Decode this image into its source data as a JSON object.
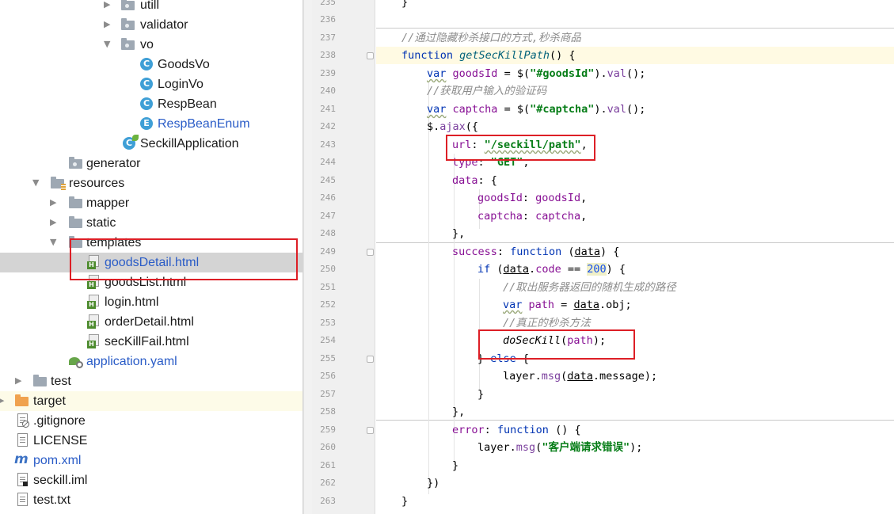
{
  "tree": {
    "items": [
      {
        "label": "utill",
        "type": "folder"
      },
      {
        "label": "validator",
        "type": "folder"
      },
      {
        "label": "vo",
        "type": "folder"
      },
      {
        "label": "GoodsVo",
        "type": "class"
      },
      {
        "label": "LoginVo",
        "type": "class"
      },
      {
        "label": "RespBean",
        "type": "class"
      },
      {
        "label": "RespBeanEnum",
        "type": "enum"
      },
      {
        "label": "SeckillApplication",
        "type": "spring-class"
      },
      {
        "label": "generator",
        "type": "folder"
      },
      {
        "label": "resources",
        "type": "resources-folder"
      },
      {
        "label": "mapper",
        "type": "folder"
      },
      {
        "label": "static",
        "type": "folder"
      },
      {
        "label": "templates",
        "type": "folder"
      },
      {
        "label": "goodsDetail.html",
        "type": "html"
      },
      {
        "label": "goodsList.html",
        "type": "html"
      },
      {
        "label": "login.html",
        "type": "html"
      },
      {
        "label": "orderDetail.html",
        "type": "html"
      },
      {
        "label": "secKillFail.html",
        "type": "html"
      },
      {
        "label": "application.yaml",
        "type": "yaml"
      },
      {
        "label": "test",
        "type": "folder"
      },
      {
        "label": "target",
        "type": "excluded-folder"
      },
      {
        "label": ".gitignore",
        "type": "file"
      },
      {
        "label": "LICENSE",
        "type": "file"
      },
      {
        "label": "pom.xml",
        "type": "maven"
      },
      {
        "label": "seckill.iml",
        "type": "iml"
      },
      {
        "label": "test.txt",
        "type": "file"
      }
    ]
  },
  "editor": {
    "line_numbers": [
      "235",
      "236",
      "237",
      "238",
      "239",
      "240",
      "241",
      "242",
      "243",
      "244",
      "245",
      "246",
      "247",
      "248",
      "249",
      "250",
      "251",
      "252",
      "253",
      "254",
      "255",
      "256",
      "257",
      "258",
      "259",
      "260",
      "261",
      "262",
      "263"
    ],
    "tokens": {
      "l235_brace": "}",
      "l237_comment": "//通过隐藏秒杀接口的方式,秒杀商品",
      "l238_kw": "function",
      "l238_name": "getSecKillPath",
      "l238_rest": "() {",
      "l239_var": "var",
      "l239_name": "goodsId",
      "l239_eq": " = $(",
      "l239_str": "\"#goodsId\"",
      "l239_dot": ").",
      "l239_call": "val",
      "l239_end": "();",
      "l240_comment": "//获取用户输入的验证码",
      "l241_var": "var",
      "l241_name": "captcha",
      "l241_eq": " = $(",
      "l241_str": "\"#captcha\"",
      "l241_dot": ").",
      "l241_call": "val",
      "l241_end": "();",
      "l242_obj": "$.",
      "l242_call": "ajax",
      "l242_end": "({",
      "l243_key": "url",
      "l243_colon": ": ",
      "l243_str": "\"/seckill/path\"",
      "l243_end": ",",
      "l244_key": "type",
      "l244_colon": ": ",
      "l244_str": "\"GET\"",
      "l244_end": ",",
      "l245_key": "data",
      "l245_end": ": {",
      "l246_key": "goodsId",
      "l246_colon": ": ",
      "l246_val": "goodsId",
      "l246_end": ",",
      "l247_key": "captcha",
      "l247_colon": ": ",
      "l247_val": "captcha",
      "l247_end": ",",
      "l248_end": "},",
      "l249_key": "success",
      "l249_colon": ": ",
      "l249_kw": "function",
      "l249_open": " (",
      "l249_param": "data",
      "l249_close": ") {",
      "l250_kw": "if",
      "l250_open": " (",
      "l250_param": "data",
      "l250_dot": ".",
      "l250_prop": "code",
      "l250_op": " == ",
      "l250_num": "200",
      "l250_end": ") {",
      "l251_comment": "//取出服务器返回的随机生成的路径",
      "l252_var": "var",
      "l252_name": "path",
      "l252_eq": " = ",
      "l252_param": "data",
      "l252_end": ".obj;",
      "l253_comment": "//真正的秒杀方法",
      "l254_fn": "doSecKill",
      "l254_open": "(",
      "l254_arg": "path",
      "l254_end": ");",
      "l255_brace": "} ",
      "l255_kw": "else",
      "l255_end": " {",
      "l256_obj": "layer.",
      "l256_call": "msg",
      "l256_open": "(",
      "l256_param": "data",
      "l256_end": ".message);",
      "l257_brace": "}",
      "l258_brace": "},",
      "l259_key": "error",
      "l259_colon": ": ",
      "l259_kw": "function",
      "l259_end": " () {",
      "l260_obj": "layer.",
      "l260_call": "msg",
      "l260_open": "(",
      "l260_str": "\"客户端请求错误\"",
      "l260_end": ");",
      "l261_brace": "}",
      "l262_brace": "})",
      "l263_brace": "}"
    }
  },
  "colors": {
    "keyword": "#0033b3",
    "string": "#067d17",
    "comment": "#8c8c8c",
    "property": "#871094",
    "number": "#1750eb",
    "annotation_box": "#dd1f26",
    "current_line": "#fffae3",
    "selection": "#d4d4d4"
  }
}
